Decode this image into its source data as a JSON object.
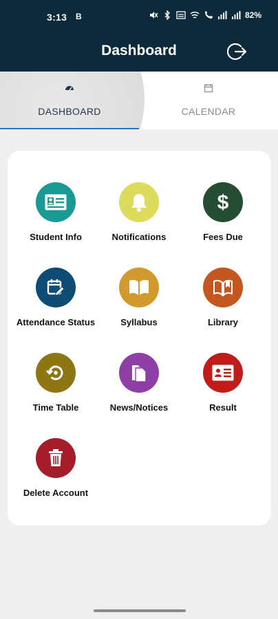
{
  "status_bar": {
    "time": "3:13",
    "sim_label": "B",
    "battery": "82%"
  },
  "app_bar": {
    "title": "Dashboard",
    "logout_icon": "logout-icon"
  },
  "tabs": [
    {
      "label": "DASHBOARD",
      "icon": "dashboard-icon",
      "active": true
    },
    {
      "label": "CALENDAR",
      "icon": "calendar-icon",
      "active": false
    }
  ],
  "tiles": [
    {
      "label": "Student Info",
      "icon": "id-card-icon",
      "color": "#1a9a94"
    },
    {
      "label": "Notifications",
      "icon": "bell-icon",
      "color": "#dddb5b"
    },
    {
      "label": "Fees Due",
      "icon": "dollar-icon",
      "color": "#254d33"
    },
    {
      "label": "Attendance Status",
      "icon": "calendar-edit-icon",
      "color": "#0f4c73"
    },
    {
      "label": "Syllabus",
      "icon": "book-icon",
      "color": "#d29a2c"
    },
    {
      "label": "Library",
      "icon": "library-book-icon",
      "color": "#c3571f"
    },
    {
      "label": "Time Table",
      "icon": "history-icon",
      "color": "#8f7614"
    },
    {
      "label": "News/Notices",
      "icon": "document-icon",
      "color": "#8e3ea5"
    },
    {
      "label": "Result",
      "icon": "result-card-icon",
      "color": "#c01d1a"
    },
    {
      "label": "Delete Account",
      "icon": "trash-icon",
      "color": "#a51c2a"
    }
  ]
}
